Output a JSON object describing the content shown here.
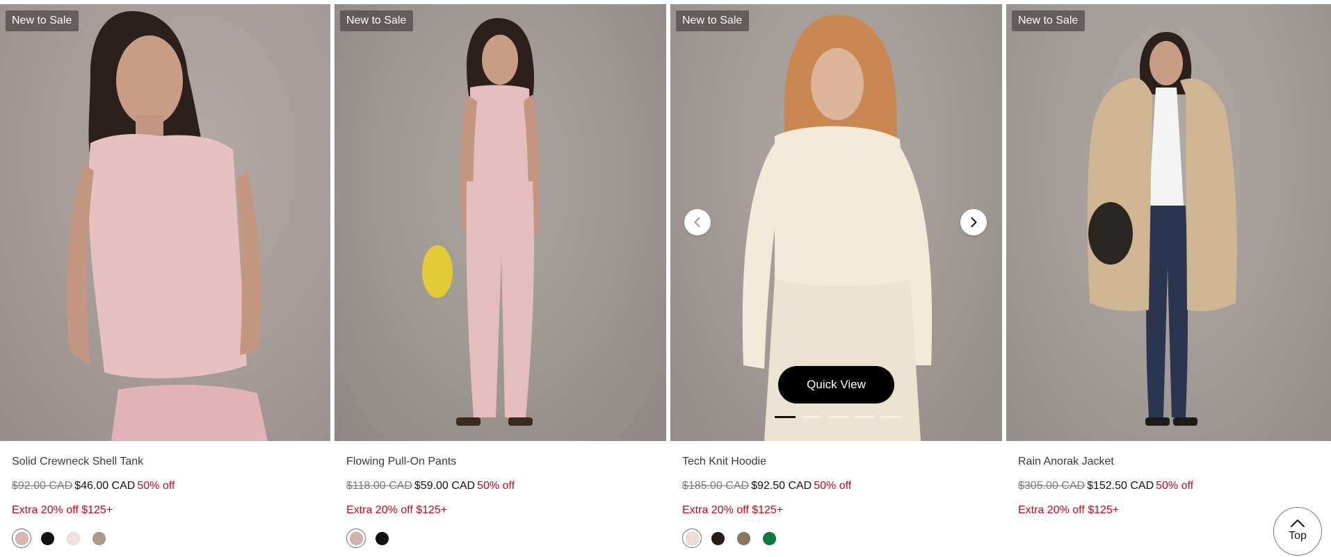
{
  "products": [
    {
      "badge": "New to Sale",
      "name": "Solid Crewneck Shell Tank",
      "original_price": "$92.00 CAD",
      "sale_price": "$46.00 CAD",
      "discount": "50% off",
      "promo": "Extra 20% off $125+",
      "garment_color": "#e8bfc2",
      "swatches": [
        {
          "color": "#d9b5b3",
          "selected": true
        },
        {
          "color": "#111111",
          "selected": false
        },
        {
          "color": "#efe1df",
          "selected": false
        },
        {
          "color": "#b09a86",
          "selected": false
        }
      ]
    },
    {
      "badge": "New to Sale",
      "name": "Flowing Pull-On Pants",
      "original_price": "$118.00 CAD",
      "sale_price": "$59.00 CAD",
      "discount": "50% off",
      "promo": "Extra 20% off $125+",
      "garment_color": "#e6bdbe",
      "swatches": [
        {
          "color": "#d4b0ae",
          "selected": true
        },
        {
          "color": "#111111",
          "selected": false
        }
      ]
    },
    {
      "badge": "New to Sale",
      "name": "Tech Knit Hoodie",
      "original_price": "$185.00 CAD",
      "sale_price": "$92.50 CAD",
      "discount": "50% off",
      "promo": "Extra 20% off $125+",
      "garment_color": "#f2ead7",
      "quick_view": "Quick View",
      "carousel_slides": 5,
      "carousel_active": 1,
      "swatches": [
        {
          "color": "#efdcd6",
          "selected": true
        },
        {
          "color": "#2a1b16",
          "selected": false
        },
        {
          "color": "#8a7464",
          "selected": false
        },
        {
          "color": "#0b7a3e",
          "selected": false
        }
      ]
    },
    {
      "badge": "New to Sale",
      "name": "Rain Anorak Jacket",
      "original_price": "$305.00 CAD",
      "sale_price": "$152.50 CAD",
      "discount": "50% off",
      "promo": "Extra 20% off $125+",
      "garment_color": "#cdb691",
      "swatches": []
    }
  ],
  "back_to_top": {
    "label": "Top",
    "icon": "chevron-up-icon"
  },
  "colors": {
    "sale_red": "#d0021b",
    "badge_bg": "#55504e"
  }
}
